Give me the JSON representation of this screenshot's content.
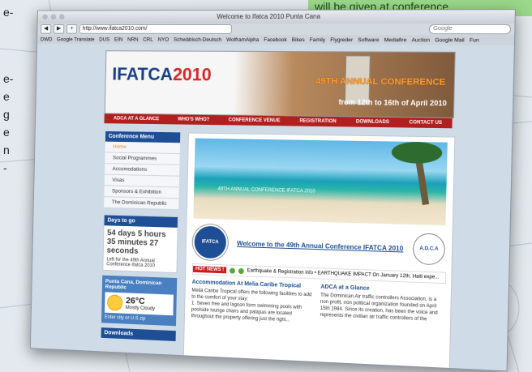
{
  "outer": {
    "side_lines": [
      "e-",
      "e-",
      "e",
      "g",
      "e",
      "n",
      "-"
    ],
    "callout_text": "will be given at conference"
  },
  "browser": {
    "window_title": "Welcome to Ifatca 2010 Punta Cana",
    "url": "http://www.ifatca2010.com/",
    "search_placeholder": "Google",
    "bookmarks": [
      "DWD",
      "Google Translate",
      "DUS",
      "EIN",
      "NRN",
      "CRL",
      "NYO",
      "Schwäbisch-Deutsch",
      "WolframAlpha",
      "Facebook",
      "Bikes",
      "Family",
      "Flygreder",
      "Software",
      "Mediafire",
      "Auction",
      "Google Mail",
      "Fun"
    ]
  },
  "site": {
    "logo_main": "IFATCA",
    "logo_year": "2010",
    "banner_annual": "49TH ANNUAL CONFERENCE",
    "banner_dates": "from 12th to 16th of April 2010",
    "menu": [
      "ADCA AT A GLANCE",
      "WHO'S WHO?",
      "CONFERENCE VENUE",
      "REGISTRATION",
      "DOWNLOADS",
      "CONTACT US"
    ],
    "sidebar": {
      "title": "Conference Menu",
      "items": [
        "Home",
        "Social Programmes",
        "Accomodations",
        "Visas",
        "Sponsors & Exhibition",
        "The Dominican Republic"
      ],
      "days_title": "Days to go",
      "days_counter": "54 days 5 hours 35 minutes 27 seconds",
      "days_caption": "Left for the 49th Annual Conference Ifatca 2010",
      "weather_location": "Punta Cana, Dominican Republic",
      "temperature": "26°C",
      "condition": "Mostly Cloudy",
      "enter_city": "Enter city or U.S zip",
      "downloads_title": "Downloads"
    },
    "hero_caption": "49TH ANNUAL CONFERENCE IFATCA 2010",
    "emblem_text": "IFATCA",
    "welcome_text": "Welcome to the 49th Annual Conference IFATCA 2010",
    "adca_text": "A.D.C.A",
    "hot_news_label": "HOT NEWS !",
    "hot_news_text": "Earthquake & Registration info • EARTHQUAKE IMPACT On January 12th, Haiti expe...",
    "accommodation_title": "Accommodation At Melia Caribe Tropical",
    "accommodation_sub": "Meliá Caribe Tropical offers the following facilities to add to the comfort of your stay:",
    "accommodation_item": "1. Seven free and lagoon form swimming pools with poolside lounge chairs and palapas are located throughout the property offering just the right...",
    "adca_title": "ADCA at a Glance",
    "adca_body": "The Dominican Air traffic controllers Association, is a non profit, non political organization founded on April 15th 1984. Since its creation, has been the voice and represents the civilian air traffic controllers of the"
  },
  "colors": {
    "brand_blue": "#1e4e95",
    "brand_red": "#b21f1f",
    "hot_red": "#c81e1e",
    "callout_green": "#9bd88a"
  }
}
